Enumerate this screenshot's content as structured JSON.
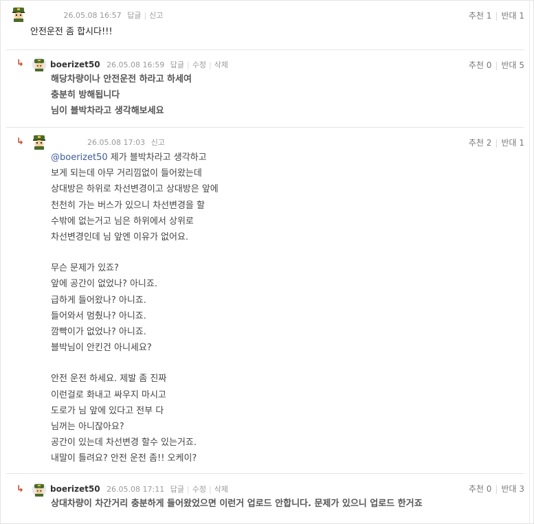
{
  "comments": [
    {
      "date": "26.05.08 16:57",
      "actions": [
        "답글",
        "신고"
      ],
      "votes": {
        "up_label": "추천",
        "up": "1",
        "down_label": "반대",
        "down": "1"
      },
      "lines": [
        "안전운전 좀 합시다!!!"
      ]
    },
    {
      "nick": "boerizet50",
      "date": "26.05.08 16:59",
      "actions": [
        "답글",
        "수정",
        "삭제"
      ],
      "votes": {
        "up_label": "추천",
        "up": "0",
        "down_label": "반대",
        "down": "5"
      },
      "lines": [
        "해당차량이나 안전운전 하라고 하세여",
        "충분히 방해됩니다",
        "님이 블박차라고 생각해보세요"
      ]
    },
    {
      "date": "26.05.08 17:03",
      "actions": [
        "신고"
      ],
      "votes": {
        "up_label": "추천",
        "up": "2",
        "down_label": "반대",
        "down": "1"
      },
      "mention": "@boerizet50",
      "first_line_rest": " 제가 블박차라고 생각하고",
      "lines": [
        "보게 되는데 아무 거리낌없이 들어왔는데",
        "상대방은 하위로 차선변경이고 상대방은 앞에",
        "천천히 가는 버스가 있으니 차선변경을 할",
        "수밖에 없는거고 님은 하위에서 상위로",
        "차선변경인데 님 앞엔 이유가 없어요.",
        "",
        "무슨 문제가 있죠?",
        "앞에 공간이 없었나? 아니죠.",
        "급하게 들어왔나? 아니죠.",
        "들어와서 멈췄나? 아니죠.",
        "깜빡이가 없었나? 아니죠.",
        "블박님이 안킨건 아니세요?",
        "",
        "안전 운전 하세요. 제발 좀 진짜",
        "이런걸로 화내고 싸우지 마시고",
        "도로가 님 앞에 있다고 전부 다",
        "님꺼는 아니잖아요?",
        "공간이 있는데 차선변경 할수 있는거죠.",
        "내말이 틀려요? 안전 운전 좀!! 오케이?"
      ]
    },
    {
      "nick": "boerizet50",
      "date": "26.05.08 17:11",
      "actions": [
        "답글",
        "수정",
        "삭제"
      ],
      "votes": {
        "up_label": "추천",
        "up": "0",
        "down_label": "반대",
        "down": "3"
      },
      "lines": [
        "상대차량이 차간거리 충분하게 들어왔었으면 이런거 업로드 안합니다. 문제가 있으니 업로드 한거죠"
      ]
    }
  ],
  "reply_arrow": "↳",
  "icons": {
    "avatar": "soldier-avatar-icon",
    "reply": "reply-arrow-icon"
  },
  "colors": {
    "reply_arrow": "#c8452a",
    "mention": "#3b5b9a"
  }
}
